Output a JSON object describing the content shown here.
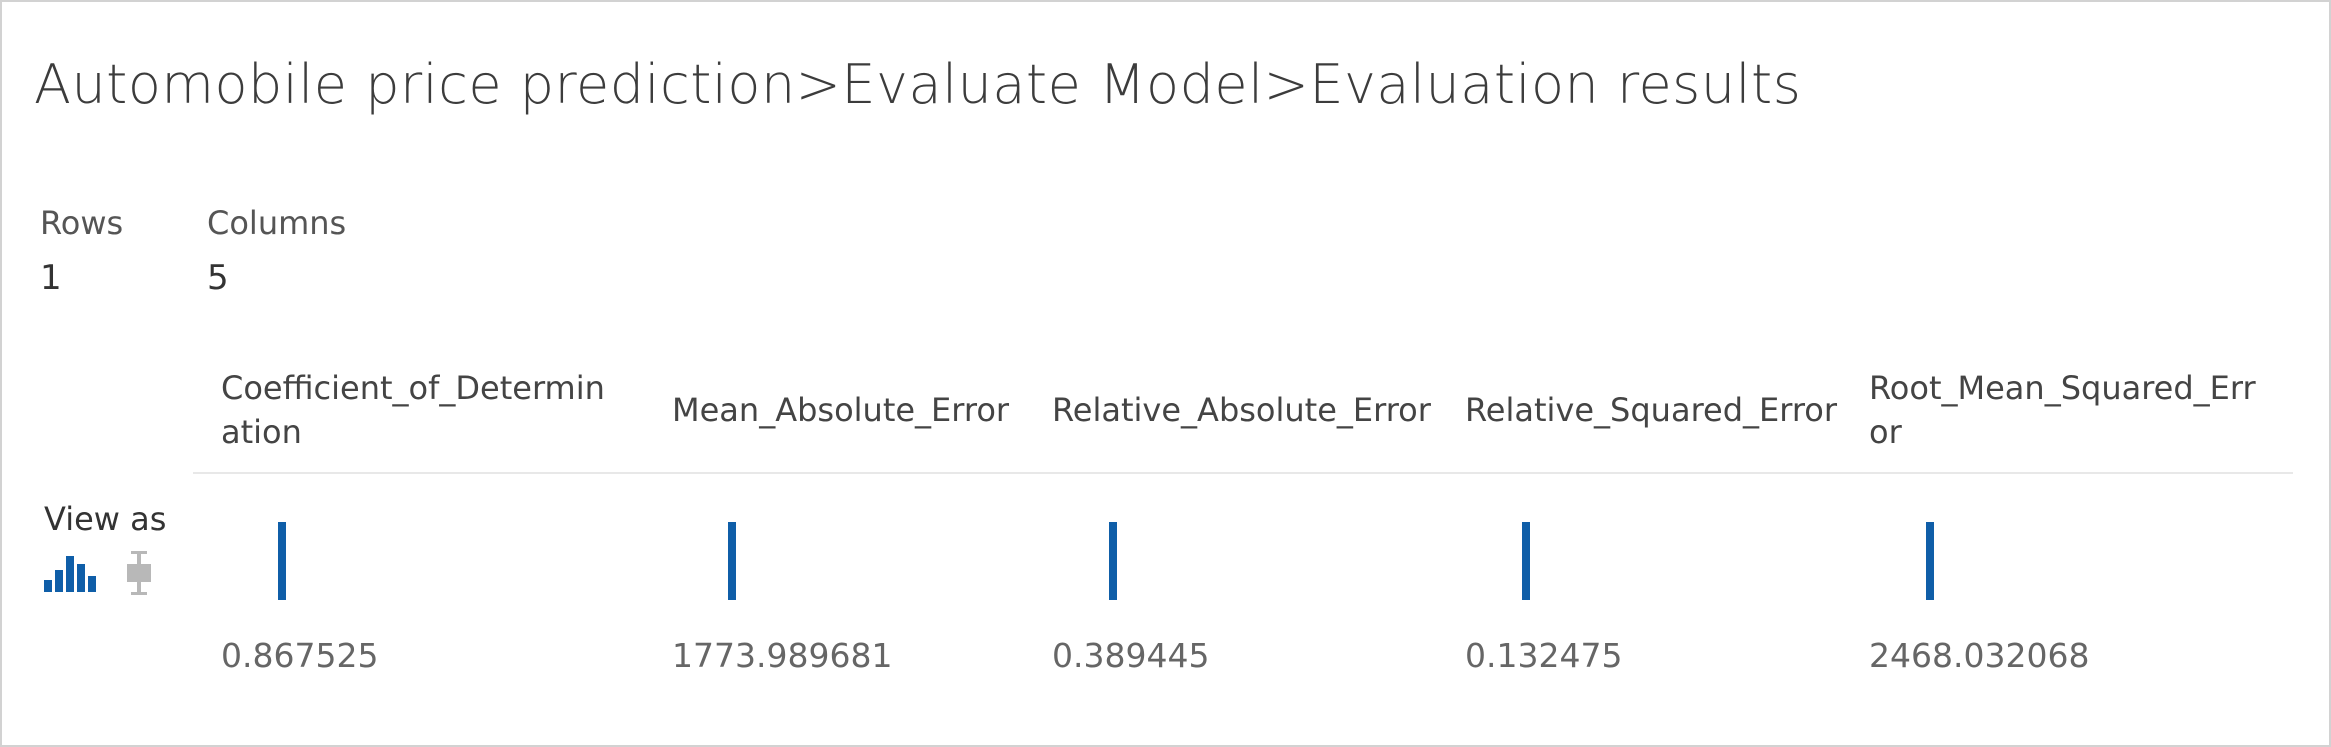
{
  "breadcrumb": {
    "dataset": "Automobile price prediction",
    "separator": ">",
    "module": "Evaluate Model",
    "output": "Evaluation results"
  },
  "summary": {
    "rows_label": "Rows",
    "rows_value": "1",
    "columns_label": "Columns",
    "columns_value": "5"
  },
  "view_as": {
    "label": "View as",
    "histogram_icon": "histogram-icon",
    "boxplot_icon": "boxplot-icon",
    "selected": "histogram"
  },
  "table": {
    "columns": [
      "Coefficient_of_Determination",
      "Mean_Absolute_Error",
      "Relative_Absolute_Error",
      "Relative_Squared_Error",
      "Root_Mean_Squared_Error"
    ],
    "values": [
      "0.867525",
      "1773.989681",
      "0.389445",
      "0.132475",
      "2468.032068"
    ]
  },
  "colors": {
    "accent": "#0f5ea8",
    "inactive_icon": "#b8b8b8",
    "divider": "#e8e8e8"
  }
}
